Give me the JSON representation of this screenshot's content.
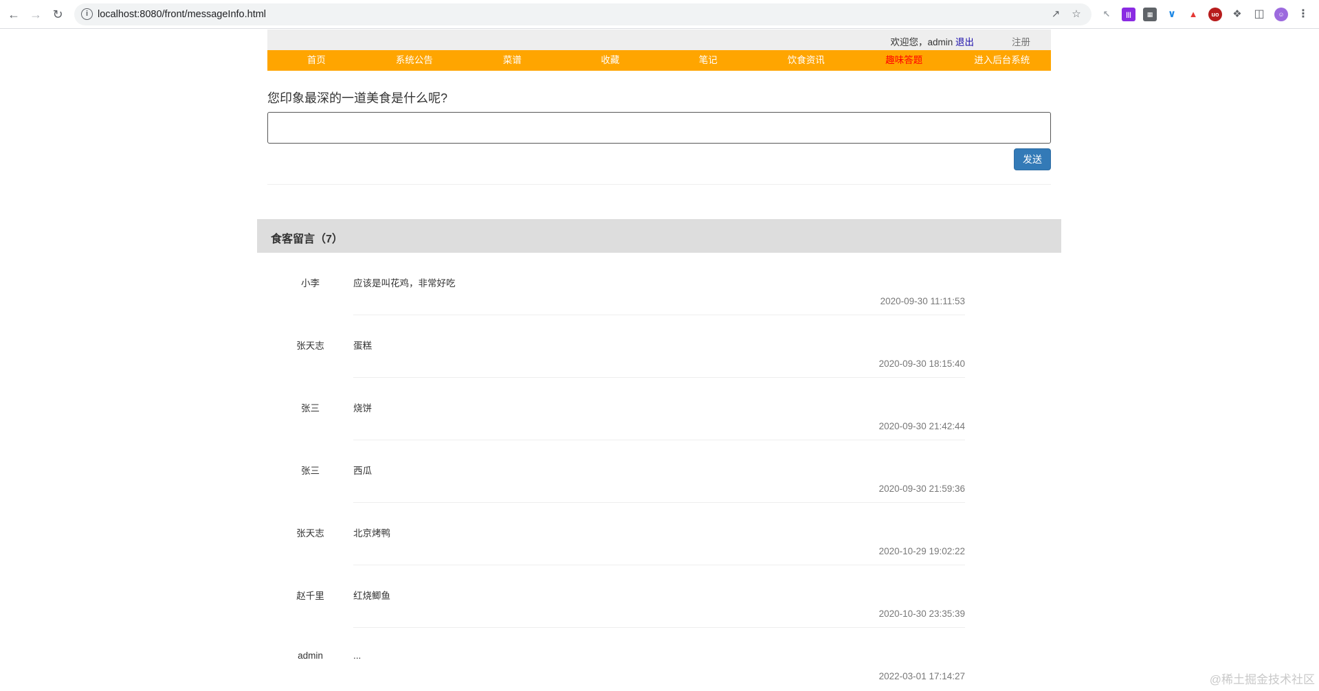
{
  "browser": {
    "url": "localhost:8080/front/messageInfo.html"
  },
  "topbar": {
    "welcome_prefix": "欢迎您，admin ",
    "logout_label": "退出",
    "register_label": "注册"
  },
  "menu": {
    "items": [
      {
        "label": "首页"
      },
      {
        "label": "系统公告"
      },
      {
        "label": "菜谱"
      },
      {
        "label": "收藏"
      },
      {
        "label": "笔记"
      },
      {
        "label": "饮食资讯"
      },
      {
        "label": "趣味答题",
        "active": true
      },
      {
        "label": "进入后台系统"
      }
    ]
  },
  "form": {
    "question": "您印象最深的一道美食是什么呢?",
    "input_value": "",
    "send_label": "发送"
  },
  "panel": {
    "title": "食客留言（7）"
  },
  "comments": [
    {
      "user": "小李",
      "text": "应该是叫花鸡，非常好吃",
      "time": "2020-09-30 11:11:53"
    },
    {
      "user": "张天志",
      "text": "蛋糕",
      "time": "2020-09-30 18:15:40"
    },
    {
      "user": "张三",
      "text": "烧饼",
      "time": "2020-09-30 21:42:44"
    },
    {
      "user": "张三",
      "text": "西瓜",
      "time": "2020-09-30 21:59:36"
    },
    {
      "user": "张天志",
      "text": "北京烤鸭",
      "time": "2020-10-29 19:02:22"
    },
    {
      "user": "赵千里",
      "text": "红烧鲫鱼",
      "time": "2020-10-30 23:35:39"
    },
    {
      "user": "admin",
      "text": "...",
      "time": "2022-03-01 17:14:27"
    }
  ],
  "watermark": "@稀土掘金技术社区",
  "colors": {
    "menu_bg": "#ffa500",
    "menu_active": "#ff0000",
    "button_primary": "#337ab7"
  }
}
